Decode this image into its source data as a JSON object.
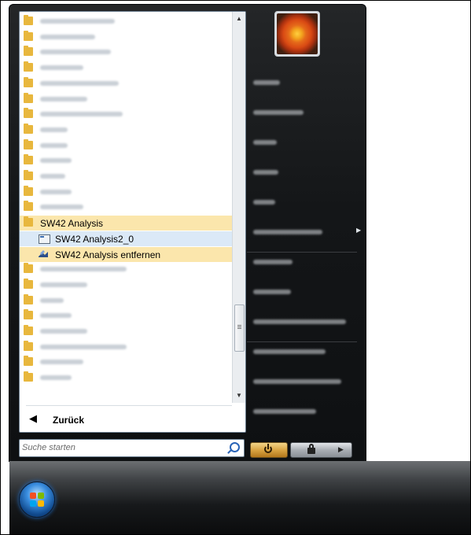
{
  "programs": {
    "items": [
      {
        "label": "",
        "kind": "folder",
        "blur_w": 95
      },
      {
        "label": "",
        "kind": "folder",
        "blur_w": 70
      },
      {
        "label": "",
        "kind": "folder",
        "blur_w": 90
      },
      {
        "label": "",
        "kind": "folder",
        "blur_w": 55
      },
      {
        "label": "",
        "kind": "folder",
        "blur_w": 100
      },
      {
        "label": "",
        "kind": "folder",
        "blur_w": 60
      },
      {
        "label": "",
        "kind": "folder",
        "blur_w": 105
      },
      {
        "label": "",
        "kind": "folder",
        "blur_w": 35
      },
      {
        "label": "",
        "kind": "folder",
        "blur_w": 35
      },
      {
        "label": "",
        "kind": "folder",
        "blur_w": 40
      },
      {
        "label": "",
        "kind": "folder",
        "blur_w": 32
      },
      {
        "label": "",
        "kind": "folder",
        "blur_w": 40
      },
      {
        "label": "",
        "kind": "folder",
        "blur_w": 55
      },
      {
        "label": "SW42 Analysis",
        "kind": "folder",
        "state": "selected"
      },
      {
        "label": "SW42 Analysis2_0",
        "kind": "app",
        "state": "hover"
      },
      {
        "label": "SW42 Analysis entfernen",
        "kind": "uninstall",
        "state": "selected"
      },
      {
        "label": "",
        "kind": "folder",
        "blur_w": 110
      },
      {
        "label": "",
        "kind": "folder",
        "blur_w": 60
      },
      {
        "label": "",
        "kind": "folder",
        "blur_w": 30
      },
      {
        "label": "",
        "kind": "folder",
        "blur_w": 40
      },
      {
        "label": "",
        "kind": "folder",
        "blur_w": 60
      },
      {
        "label": "",
        "kind": "folder",
        "blur_w": 110
      },
      {
        "label": "",
        "kind": "folder",
        "blur_w": 55
      },
      {
        "label": "",
        "kind": "folder",
        "blur_w": 40
      }
    ]
  },
  "back_label": "Zurück",
  "search": {
    "placeholder": "Suche starten",
    "value": ""
  },
  "right_pane": {
    "items": [
      {
        "label": "",
        "blur_w": 34
      },
      {
        "label": "",
        "blur_w": 64
      },
      {
        "label": "",
        "blur_w": 30
      },
      {
        "label": "",
        "blur_w": 32
      },
      {
        "label": "",
        "blur_w": 28
      },
      {
        "label": "",
        "blur_w": 88,
        "submenu": true
      },
      {
        "label": "",
        "blur_w": 50
      },
      {
        "label": "",
        "blur_w": 48
      },
      {
        "label": "",
        "blur_w": 118
      },
      {
        "label": "",
        "blur_w": 92
      },
      {
        "label": "",
        "blur_w": 112
      },
      {
        "label": "",
        "blur_w": 80
      }
    ]
  },
  "icons": {
    "folder": "folder-icon",
    "app": "application-icon",
    "uninstall": "uninstall-icon",
    "back": "back-arrow-icon",
    "search": "search-icon",
    "power": "power-icon",
    "lock": "lock-icon",
    "more": "arrow-right-icon",
    "start": "windows-start-orb"
  },
  "colors": {
    "folder": "#e8b73d",
    "selected_background": "#fbe6ac",
    "hover_background": "#dbe9f7",
    "menu_background": "#141618",
    "power_button": "#d9a443"
  }
}
